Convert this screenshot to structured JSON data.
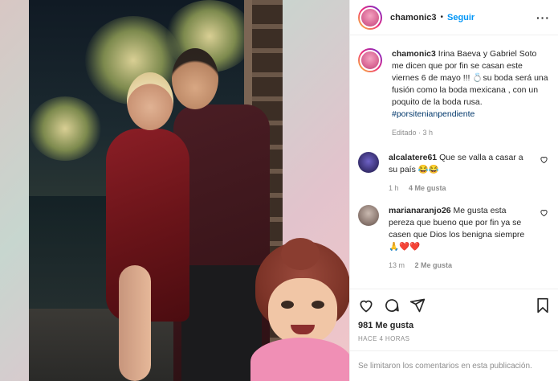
{
  "header": {
    "username": "chamonic3",
    "separator": "•",
    "follow_label": "Seguir",
    "more_label": "···"
  },
  "caption": {
    "username": "chamonic3",
    "text": "Irina Baeva y Gabriel Soto me dicen que por fin se casan este viernes 6 de mayo !!! 💍su boda será una fusión como la boda mexicana , con un poquito de la boda rusa.",
    "hashtag": "#porsitenianpendiente",
    "edited": "Editado · 3 h"
  },
  "comments": [
    {
      "username": "alcalatere61",
      "text": "Que se valla a casar a su país 😂😂",
      "time": "1 h",
      "likes": "4 Me gusta"
    },
    {
      "username": "marianaranjo26",
      "text": "Me gusta esta pereza que bueno que por fin ya se casen que Dios los benigna siempre 🙏❤️❤️",
      "time": "13 m",
      "likes": "2 Me gusta"
    }
  ],
  "icons": {
    "like": "heart-icon",
    "comment": "comment-icon",
    "share": "share-icon",
    "save": "bookmark-icon"
  },
  "stats": {
    "likes": "981 Me gusta",
    "posted": "HACE 4 HORAS"
  },
  "footer": {
    "comments_limited": "Se limitaron los comentarios en esta publicación."
  }
}
